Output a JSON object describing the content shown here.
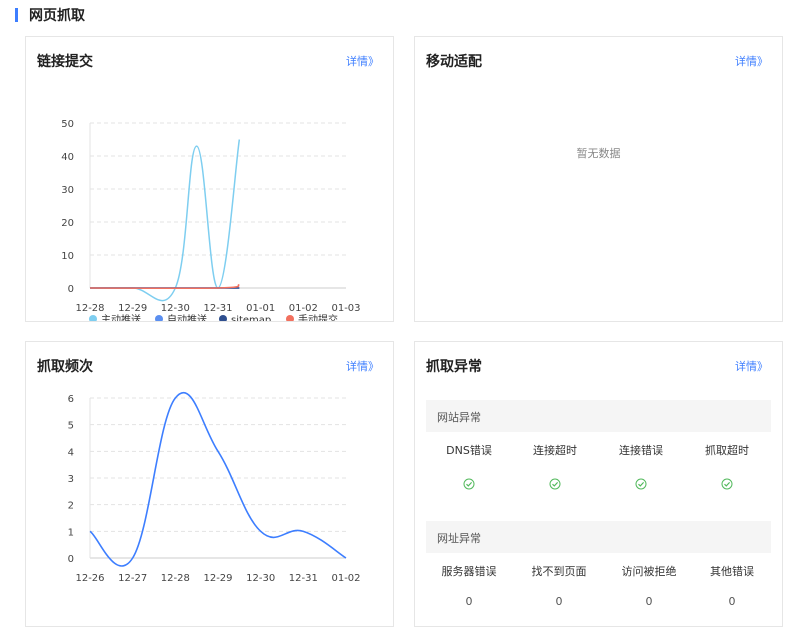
{
  "page": {
    "section_title": "网页抓取"
  },
  "cards": {
    "link_submit": {
      "title": "链接提交",
      "detail": "详情》",
      "chart_data": {
        "type": "line",
        "x": [
          "12-28",
          "12-29",
          "12-30",
          "12-31",
          "01-01",
          "01-02",
          "01-03"
        ],
        "ylim": [
          0,
          50
        ],
        "yticks": [
          0,
          10,
          20,
          30,
          40,
          50
        ],
        "grid": true,
        "legend_position": "bottom",
        "series": [
          {
            "name": "主动推送",
            "color": "#7ecef0",
            "points": [
              [
                0,
                0
              ],
              [
                1,
                0
              ],
              [
                2,
                0
              ],
              [
                2.5,
                43
              ],
              [
                3,
                0
              ],
              [
                3.5,
                45
              ]
            ]
          },
          {
            "name": "自动推送",
            "color": "#5b8ff0",
            "points": [
              [
                0,
                0
              ],
              [
                3.5,
                0
              ]
            ]
          },
          {
            "name": "sitemap",
            "color": "#2f4f8f",
            "points": [
              [
                0,
                0
              ],
              [
                3.5,
                0
              ]
            ]
          },
          {
            "name": "手动提交",
            "color": "#f2705e",
            "points": [
              [
                0,
                0
              ],
              [
                3,
                0
              ],
              [
                3.5,
                1
              ]
            ]
          }
        ]
      }
    },
    "mobile": {
      "title": "移动适配",
      "detail": "详情》",
      "empty": "暂无数据"
    },
    "crawl_freq": {
      "title": "抓取频次",
      "detail": "详情》",
      "chart_data": {
        "type": "line",
        "x": [
          "12-26",
          "12-27",
          "12-28",
          "12-29",
          "12-30",
          "12-31",
          "01-02"
        ],
        "ylim": [
          0,
          6
        ],
        "yticks": [
          0,
          1,
          2,
          3,
          4,
          5,
          6
        ],
        "grid": true,
        "series": [
          {
            "name": "",
            "color": "#3d7eff",
            "points": [
              [
                0,
                1
              ],
              [
                1,
                0
              ],
              [
                2,
                6
              ],
              [
                3,
                4
              ],
              [
                4,
                1
              ],
              [
                5,
                1
              ],
              [
                6,
                0
              ]
            ]
          }
        ]
      }
    },
    "crawl_error": {
      "title": "抓取异常",
      "detail": "详情》",
      "site_error": {
        "header": "网站异常",
        "items": [
          "DNS错误",
          "连接超时",
          "连接错误",
          "抓取超时"
        ]
      },
      "url_error": {
        "header": "网址异常",
        "items": [
          {
            "label": "服务器错误",
            "value": "0"
          },
          {
            "label": "找不到页面",
            "value": "0"
          },
          {
            "label": "访问被拒绝",
            "value": "0"
          },
          {
            "label": "其他错误",
            "value": "0"
          }
        ]
      },
      "ok_color": "#52b95c"
    }
  }
}
